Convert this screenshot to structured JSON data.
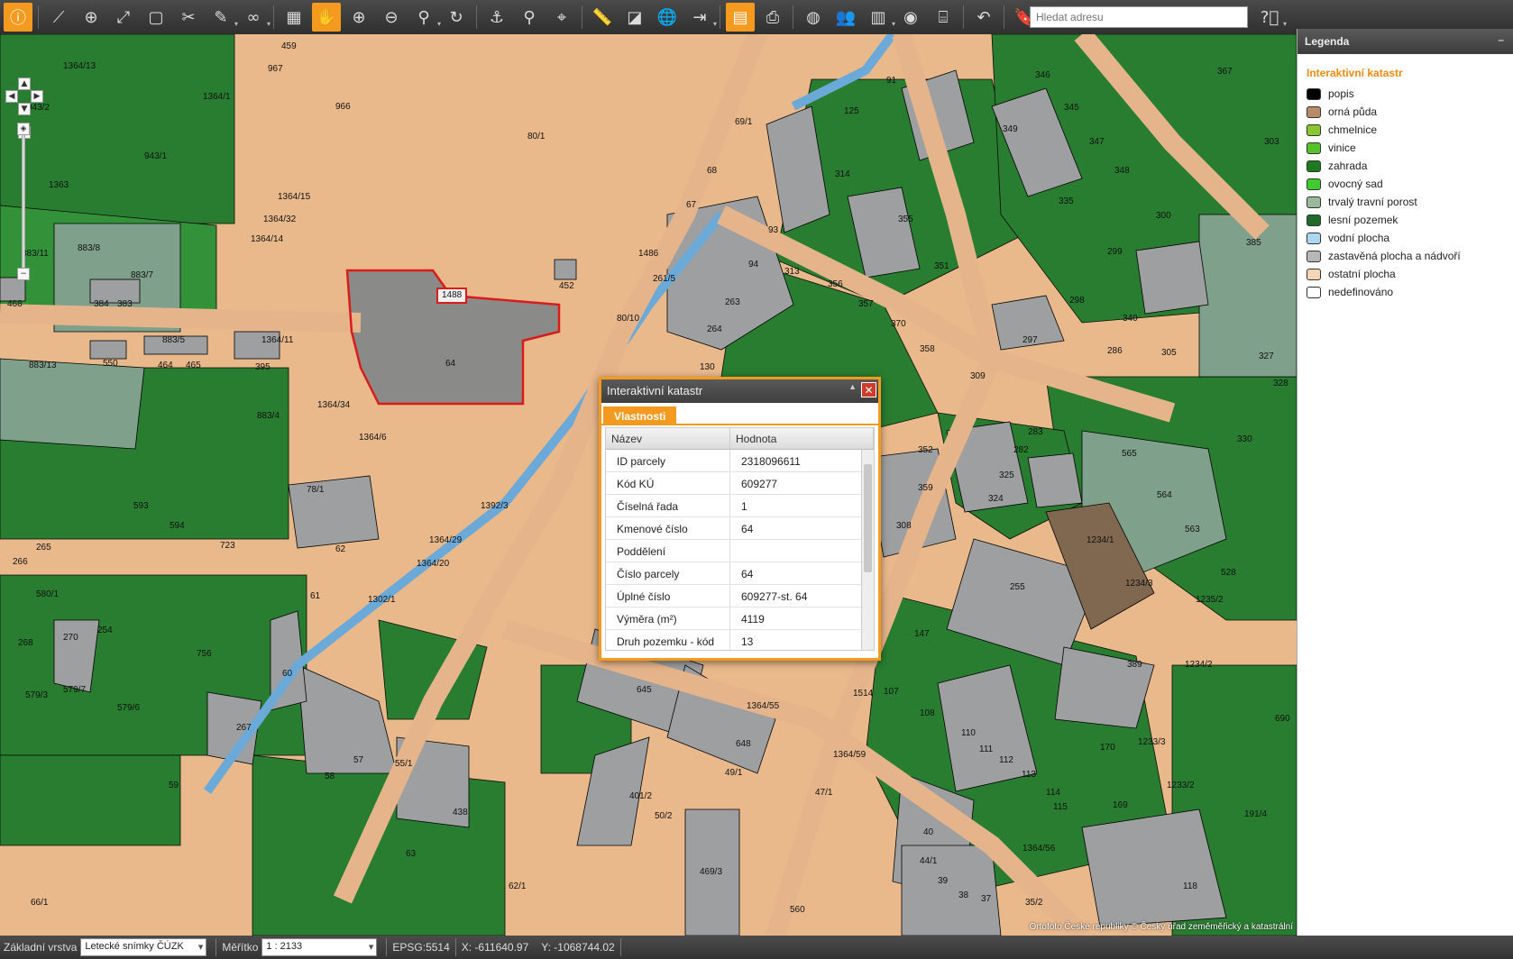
{
  "toolbar": {
    "buttons": [
      {
        "icon": "info-icon",
        "active": true
      },
      {
        "icon": "measure-line-icon"
      },
      {
        "icon": "add-point-icon"
      },
      {
        "icon": "add-line-icon"
      },
      {
        "icon": "add-polygon-icon"
      },
      {
        "icon": "delete-drawing-icon"
      },
      {
        "icon": "drawing-tools-icon",
        "dropdown": true
      },
      {
        "icon": "binoculars-icon",
        "dropdown": true
      },
      {
        "icon": "calculator-icon"
      },
      {
        "icon": "pan-hand-icon",
        "active": true
      },
      {
        "icon": "zoom-in-icon"
      },
      {
        "icon": "zoom-out-icon"
      },
      {
        "icon": "zoom-area-icon",
        "dropdown": true
      },
      {
        "icon": "refresh-icon"
      },
      {
        "icon": "anchor-icon"
      },
      {
        "icon": "location-pin-icon"
      },
      {
        "icon": "crosshair-icon"
      },
      {
        "icon": "ruler-icon"
      },
      {
        "icon": "area-measure-icon"
      },
      {
        "icon": "globe-icon"
      },
      {
        "icon": "export-icon",
        "dropdown": true
      },
      {
        "icon": "document-icon",
        "active": true
      },
      {
        "icon": "print-icon"
      },
      {
        "icon": "web-globe-icon"
      },
      {
        "icon": "people-icon"
      },
      {
        "icon": "building-icon",
        "dropdown": true
      },
      {
        "icon": "coin-icon"
      },
      {
        "icon": "bed-icon"
      },
      {
        "icon": "back-icon"
      },
      {
        "icon": "bookmark-icon"
      }
    ],
    "address_placeholder": "Hledat adresu",
    "help_icon": "help-icon"
  },
  "legend": {
    "header": "Legenda",
    "section_title": "Interaktivní katastr",
    "items": [
      {
        "label": "popis",
        "color": "#000000"
      },
      {
        "label": "orná půda",
        "color": "#b98a68"
      },
      {
        "label": "chmelnice",
        "color": "#8ac62e"
      },
      {
        "label": "vinice",
        "color": "#55c22a"
      },
      {
        "label": "zahrada",
        "color": "#1d7a1d"
      },
      {
        "label": "ovocný sad",
        "color": "#3ecb2d"
      },
      {
        "label": "trvalý travní porost",
        "color": "#9ab89a"
      },
      {
        "label": "lesní pozemek",
        "color": "#1f6a2a"
      },
      {
        "label": "vodní plocha",
        "color": "#a9d8f0"
      },
      {
        "label": "zastavěná plocha a nádvoří",
        "color": "#b7b7b7"
      },
      {
        "label": "ostatní plocha",
        "color": "#f4d6b6"
      },
      {
        "label": "nedefinováno",
        "color": "#ffffff"
      }
    ]
  },
  "popup": {
    "title": "Interaktivní katastr",
    "tab": "Vlastnosti",
    "col_name": "Název",
    "col_value": "Hodnota",
    "rows": [
      {
        "name": "ID parcely",
        "value": "2318096611"
      },
      {
        "name": "Kód KÚ",
        "value": "609277"
      },
      {
        "name": "Číselná řada",
        "value": "1"
      },
      {
        "name": "Kmenové číslo",
        "value": "64"
      },
      {
        "name": "Poddělení",
        "value": ""
      },
      {
        "name": "Číslo parcely",
        "value": "64"
      },
      {
        "name": "Úplné číslo",
        "value": "609277-st. 64"
      },
      {
        "name": "Výměra (m²)",
        "value": "4119"
      },
      {
        "name": "Druh pozemku - kód",
        "value": "13"
      }
    ]
  },
  "map": {
    "attribution": "Ortofoto České republiky © Český úřad zeměměřický a katastrální",
    "labels": [
      {
        "t": "459"
      },
      {
        "t": "967"
      },
      {
        "t": "1364/13"
      },
      {
        "t": "1364/1"
      },
      {
        "t": "966"
      },
      {
        "t": "943/2"
      },
      {
        "t": "943/1"
      },
      {
        "t": "80/1"
      },
      {
        "t": "1363"
      },
      {
        "t": "1364/15"
      },
      {
        "t": "1364/32"
      },
      {
        "t": "1364/14"
      },
      {
        "t": "883/11"
      },
      {
        "t": "883/8"
      },
      {
        "t": "883/7"
      },
      {
        "t": "468"
      },
      {
        "t": "384"
      },
      {
        "t": "383"
      },
      {
        "t": "1488"
      },
      {
        "t": "452"
      },
      {
        "t": "64"
      },
      {
        "t": "883/5"
      },
      {
        "t": "1364/11"
      },
      {
        "t": "883/13"
      },
      {
        "t": "550"
      },
      {
        "t": "464"
      },
      {
        "t": "465"
      },
      {
        "t": "395"
      },
      {
        "t": "883/4"
      },
      {
        "t": "1364/34"
      },
      {
        "t": "1364/6"
      },
      {
        "t": "78/1"
      },
      {
        "t": "1392/3"
      },
      {
        "t": "593"
      },
      {
        "t": "594"
      },
      {
        "t": "723"
      },
      {
        "t": "62"
      },
      {
        "t": "266"
      },
      {
        "t": "265"
      },
      {
        "t": "580/1"
      },
      {
        "t": "1364/29"
      },
      {
        "t": "1364/20"
      },
      {
        "t": "1302/1"
      },
      {
        "t": "61"
      },
      {
        "t": "270"
      },
      {
        "t": "268"
      },
      {
        "t": "254"
      },
      {
        "t": "756"
      },
      {
        "t": "60"
      },
      {
        "t": "579/3"
      },
      {
        "t": "579/7"
      },
      {
        "t": "579/6"
      },
      {
        "t": "267"
      },
      {
        "t": "59"
      },
      {
        "t": "58"
      },
      {
        "t": "57"
      },
      {
        "t": "55/1"
      },
      {
        "t": "438"
      },
      {
        "t": "63"
      },
      {
        "t": "62/1"
      },
      {
        "t": "66/1"
      },
      {
        "t": "645"
      },
      {
        "t": "648"
      },
      {
        "t": "49/1"
      },
      {
        "t": "401/2"
      },
      {
        "t": "50/2"
      },
      {
        "t": "47/1"
      },
      {
        "t": "469/3"
      },
      {
        "t": "560"
      },
      {
        "t": "130"
      },
      {
        "t": "264"
      },
      {
        "t": "263"
      },
      {
        "t": "94"
      },
      {
        "t": "93"
      },
      {
        "t": "313"
      },
      {
        "t": "67"
      },
      {
        "t": "68"
      },
      {
        "t": "69/1"
      },
      {
        "t": "1486"
      },
      {
        "t": "261/5"
      },
      {
        "t": "80/10"
      },
      {
        "t": "91"
      },
      {
        "t": "125"
      },
      {
        "t": "314"
      },
      {
        "t": "355"
      },
      {
        "t": "346"
      },
      {
        "t": "345"
      },
      {
        "t": "349"
      },
      {
        "t": "347"
      },
      {
        "t": "348"
      },
      {
        "t": "335"
      },
      {
        "t": "299"
      },
      {
        "t": "300"
      },
      {
        "t": "385"
      },
      {
        "t": "367"
      },
      {
        "t": "303"
      },
      {
        "t": "351"
      },
      {
        "t": "357"
      },
      {
        "t": "370"
      },
      {
        "t": "356"
      },
      {
        "t": "298"
      },
      {
        "t": "297"
      },
      {
        "t": "340"
      },
      {
        "t": "327"
      },
      {
        "t": "328"
      },
      {
        "t": "286"
      },
      {
        "t": "305"
      },
      {
        "t": "358"
      },
      {
        "t": "309"
      },
      {
        "t": "352"
      },
      {
        "t": "359"
      },
      {
        "t": "308"
      },
      {
        "t": "283"
      },
      {
        "t": "282"
      },
      {
        "t": "325"
      },
      {
        "t": "324"
      },
      {
        "t": "565"
      },
      {
        "t": "564"
      },
      {
        "t": "563"
      },
      {
        "t": "330"
      },
      {
        "t": "1234/1"
      },
      {
        "t": "1234/3"
      },
      {
        "t": "255"
      },
      {
        "t": "528"
      },
      {
        "t": "389"
      },
      {
        "t": "1234/2"
      },
      {
        "t": "147"
      },
      {
        "t": "107"
      },
      {
        "t": "108"
      },
      {
        "t": "110"
      },
      {
        "t": "111"
      },
      {
        "t": "112"
      },
      {
        "t": "113"
      },
      {
        "t": "114"
      },
      {
        "t": "115"
      },
      {
        "t": "170"
      },
      {
        "t": "169"
      },
      {
        "t": "690"
      },
      {
        "t": "191/4"
      },
      {
        "t": "118"
      },
      {
        "t": "1514"
      },
      {
        "t": "40"
      },
      {
        "t": "39"
      },
      {
        "t": "38"
      },
      {
        "t": "37"
      },
      {
        "t": "35/2"
      },
      {
        "t": "44/1"
      },
      {
        "t": "1233/2"
      },
      {
        "t": "1233/3"
      },
      {
        "t": "1364/59"
      },
      {
        "t": "1364/56"
      },
      {
        "t": "1364/55"
      },
      {
        "t": "1235/2"
      }
    ]
  },
  "status": {
    "base_layer_label": "Základní vrstva",
    "base_layer_value": "Letecké snímky ČÚZK",
    "scale_label": "Měřítko",
    "scale_value": "1 : 2133",
    "epsg": "EPSG:5514",
    "x": "X: -611640.97",
    "y": "Y: -1068744.02"
  }
}
